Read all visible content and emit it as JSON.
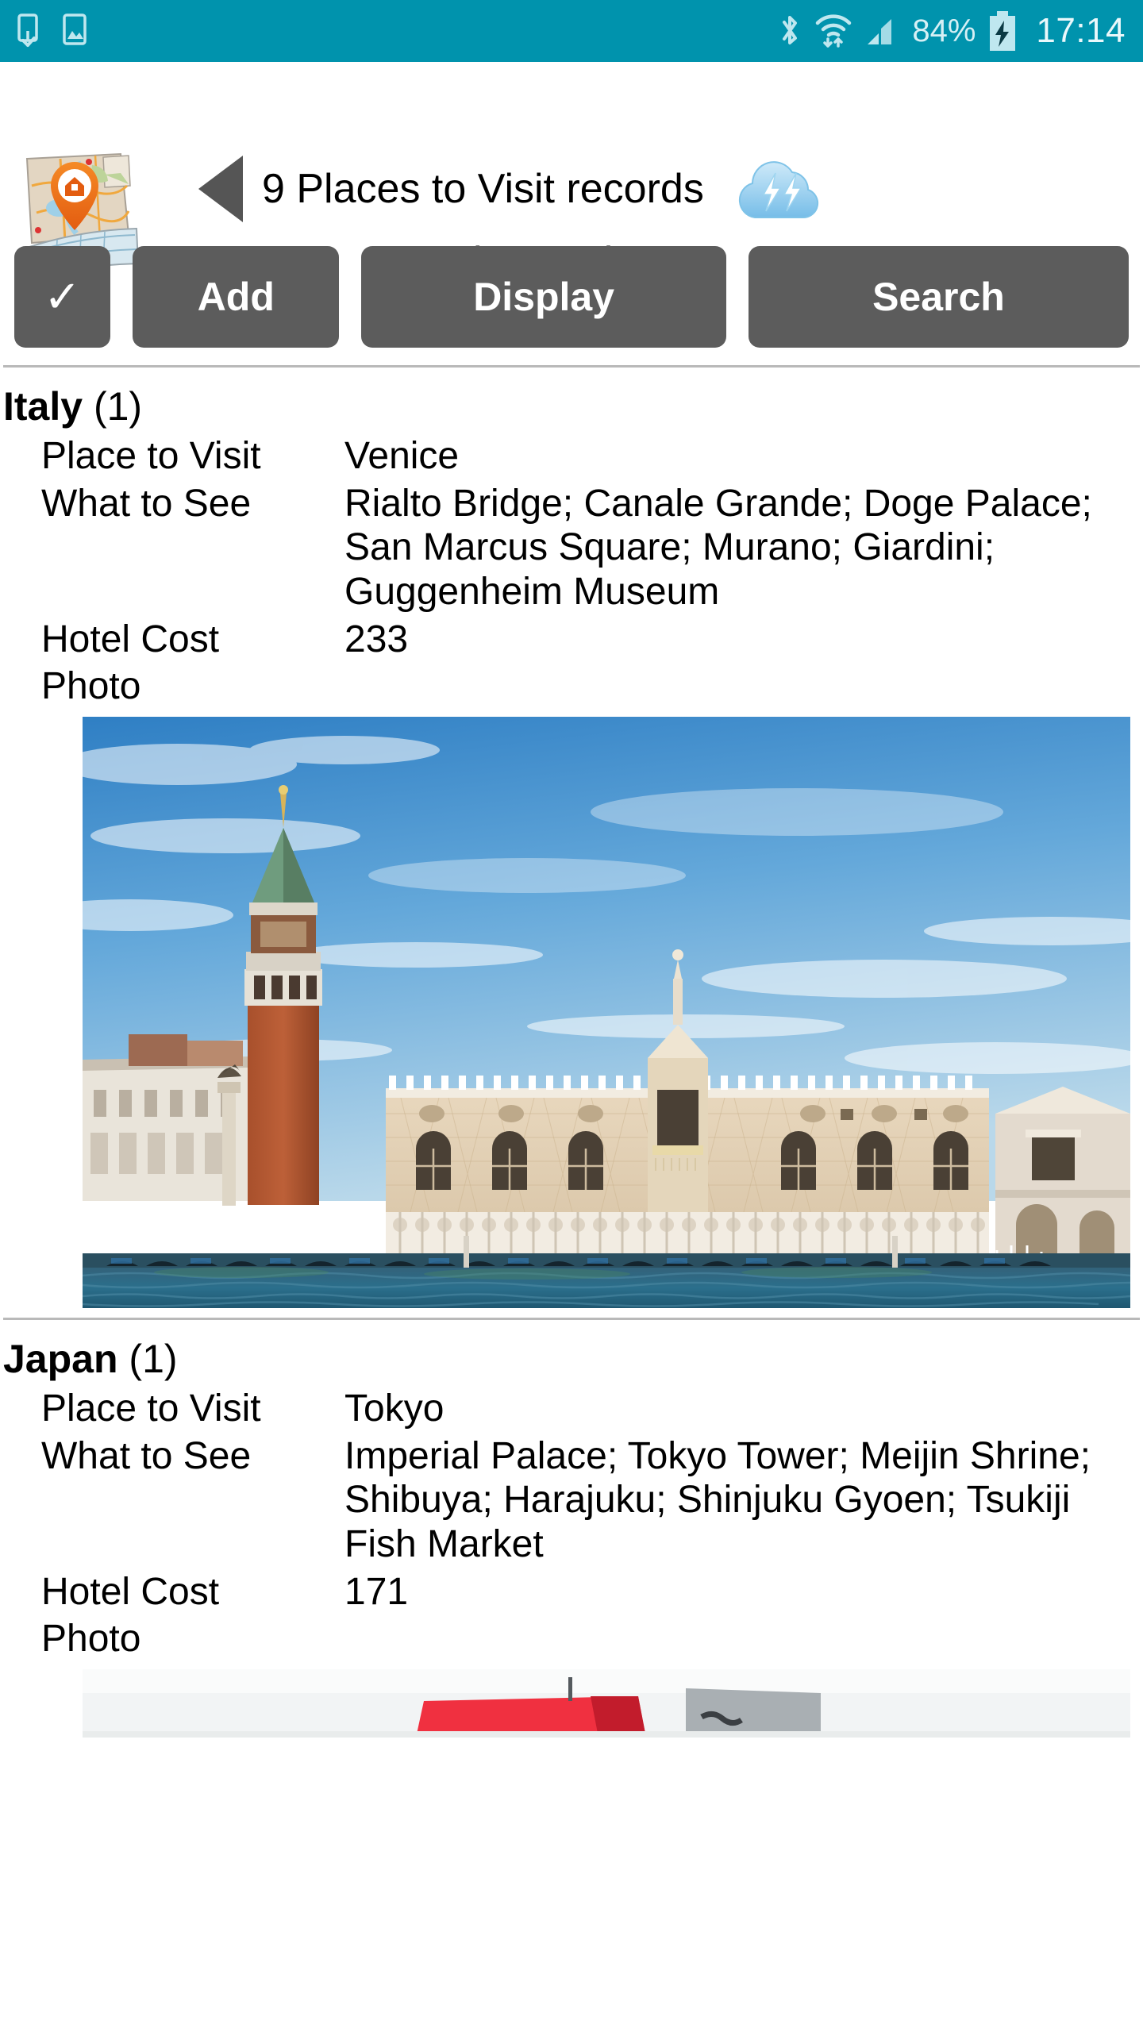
{
  "status_bar": {
    "background_color": "#0093ad",
    "notification_icons": [
      {
        "name": "download-complete-icon",
        "label": "Download complete"
      },
      {
        "name": "screenshot-image-icon",
        "label": "Screenshot captured"
      }
    ],
    "system_icons": [
      {
        "name": "bluetooth-icon",
        "label": "Bluetooth"
      },
      {
        "name": "wifi-icon",
        "label": "Wi-Fi with data transfer"
      },
      {
        "name": "cellular-signal-icon",
        "label": "Cellular signal"
      }
    ],
    "battery_percent": "84%",
    "battery_state": "charging",
    "time": "17:14"
  },
  "header": {
    "app_icon_name": "map-app-icon",
    "back_label": "Back",
    "title": "9 Places to Visit records",
    "sync_icon_name": "cloud-sync-icon",
    "list_name": "Places List"
  },
  "toolbar": {
    "buttons": [
      {
        "name": "confirm-button",
        "label": "✓"
      },
      {
        "name": "add-button",
        "label": "Add"
      },
      {
        "name": "display-button",
        "label": "Display"
      },
      {
        "name": "search-button",
        "label": "Search"
      }
    ]
  },
  "labels": {
    "place": "Place to Visit",
    "what_to_see": "What to See",
    "hotel_cost": "Hotel Cost",
    "photo": "Photo"
  },
  "groups": [
    {
      "name": "Italy",
      "count": "(1)",
      "records": [
        {
          "place": "Venice",
          "what_to_see": "Rialto Bridge; Canale Grande; Doge Palace; San Marcus Square; Murano; Giardini; Guggenheim Museum",
          "hotel_cost": "233",
          "photo_name": "venice-doge-palace-photo"
        }
      ]
    },
    {
      "name": "Japan",
      "count": "(1)",
      "records": [
        {
          "place": "Tokyo",
          "what_to_see": "Imperial Palace; Tokyo Tower; Meijin Shrine; Shibuya; Harajuku; Shinjuku Gyoen; Tsukiji Fish Market",
          "hotel_cost": "171",
          "photo_name": "tokyo-skyline-photo"
        }
      ]
    }
  ],
  "colors": {
    "status_bar": "#0093ad",
    "button": "#5c5c5c",
    "text": "#000000",
    "divider": "#b9b9b9"
  }
}
